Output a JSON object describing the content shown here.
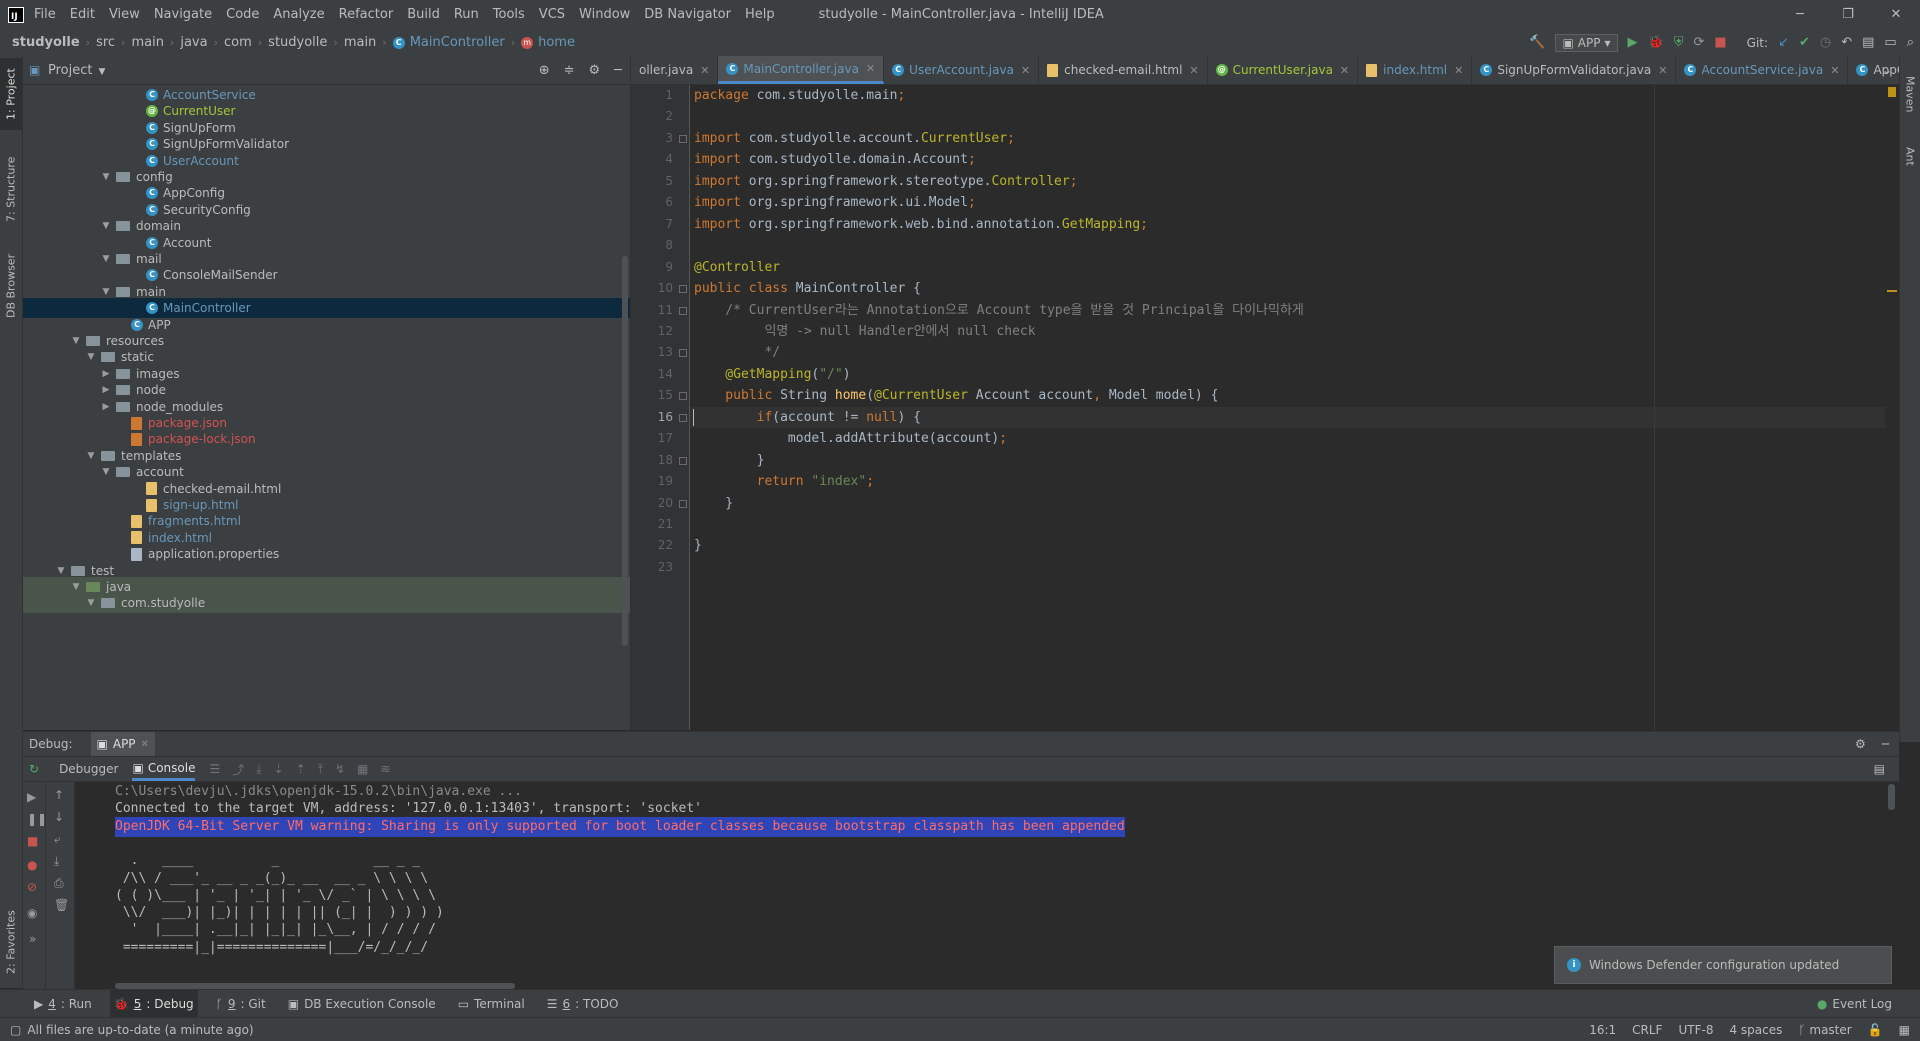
{
  "menubar": {
    "logo": "IJ",
    "items": [
      "File",
      "Edit",
      "View",
      "Navigate",
      "Code",
      "Analyze",
      "Refactor",
      "Build",
      "Run",
      "Tools",
      "VCS",
      "Window",
      "DB Navigator",
      "Help"
    ],
    "window_title": "studyolle - MainController.java - IntelliJ IDEA"
  },
  "navbar": {
    "crumbs": [
      "studyolle",
      "src",
      "main",
      "java",
      "com",
      "studyolle",
      "main",
      "MainController",
      "home"
    ],
    "run_config": "APP",
    "git_label": "Git:"
  },
  "left_strip": {
    "project": "1: Project",
    "structure": "7: Structure",
    "db_browser": "DB Browser",
    "favorites": "2: Favorites"
  },
  "right_strip": {
    "maven": "Maven",
    "ant": "Ant"
  },
  "project_panel": {
    "title": "Project",
    "tree": [
      {
        "label": "AccountService",
        "kind": "class",
        "depth": 7,
        "color": "#6897bb"
      },
      {
        "label": "CurrentUser",
        "kind": "annotation",
        "depth": 7,
        "color": "#a4c639"
      },
      {
        "label": "SignUpForm",
        "kind": "class",
        "depth": 7,
        "color": "#bbbbbb"
      },
      {
        "label": "SignUpFormValidator",
        "kind": "class",
        "depth": 7,
        "color": "#bbbbbb"
      },
      {
        "label": "UserAccount",
        "kind": "class",
        "depth": 7,
        "color": "#6897bb"
      },
      {
        "label": "config",
        "kind": "folder-open",
        "depth": 5,
        "color": "#bbbbbb"
      },
      {
        "label": "AppConfig",
        "kind": "class",
        "depth": 7,
        "color": "#bbbbbb"
      },
      {
        "label": "SecurityConfig",
        "kind": "class",
        "depth": 7,
        "color": "#bbbbbb"
      },
      {
        "label": "domain",
        "kind": "folder-open",
        "depth": 5,
        "color": "#bbbbbb"
      },
      {
        "label": "Account",
        "kind": "class",
        "depth": 7,
        "color": "#bbbbbb"
      },
      {
        "label": "mail",
        "kind": "folder-open",
        "depth": 5,
        "color": "#bbbbbb"
      },
      {
        "label": "ConsoleMailSender",
        "kind": "class",
        "depth": 7,
        "color": "#bbbbbb"
      },
      {
        "label": "main",
        "kind": "folder-open",
        "depth": 5,
        "color": "#bbbbbb"
      },
      {
        "label": "MainController",
        "kind": "class",
        "depth": 7,
        "color": "#6897bb",
        "selected": true
      },
      {
        "label": "APP",
        "kind": "app",
        "depth": 6,
        "color": "#bbbbbb"
      },
      {
        "label": "resources",
        "kind": "folder-open",
        "depth": 3,
        "color": "#bbbbbb"
      },
      {
        "label": "static",
        "kind": "folder-open",
        "depth": 4,
        "color": "#bbbbbb"
      },
      {
        "label": "images",
        "kind": "folder-closed",
        "depth": 5,
        "color": "#bbbbbb"
      },
      {
        "label": "node",
        "kind": "folder-closed",
        "depth": 5,
        "color": "#bbbbbb"
      },
      {
        "label": "node_modules",
        "kind": "folder-closed",
        "depth": 5,
        "color": "#bbbbbb"
      },
      {
        "label": "package.json",
        "kind": "json",
        "depth": 6,
        "color": "#d25252"
      },
      {
        "label": "package-lock.json",
        "kind": "json",
        "depth": 6,
        "color": "#d25252"
      },
      {
        "label": "templates",
        "kind": "folder-open",
        "depth": 4,
        "color": "#bbbbbb"
      },
      {
        "label": "account",
        "kind": "folder-open",
        "depth": 5,
        "color": "#bbbbbb"
      },
      {
        "label": "checked-email.html",
        "kind": "html",
        "depth": 7,
        "color": "#bbbbbb"
      },
      {
        "label": "sign-up.html",
        "kind": "html",
        "depth": 7,
        "color": "#6897bb"
      },
      {
        "label": "fragments.html",
        "kind": "html",
        "depth": 6,
        "color": "#6897bb"
      },
      {
        "label": "index.html",
        "kind": "html",
        "depth": 6,
        "color": "#6897bb"
      },
      {
        "label": "application.properties",
        "kind": "prop",
        "depth": 6,
        "color": "#bbbbbb"
      },
      {
        "label": "test",
        "kind": "folder-open",
        "depth": 2,
        "color": "#bbbbbb"
      },
      {
        "label": "java",
        "kind": "folder-green",
        "depth": 3,
        "color": "#bbbbbb",
        "test": true
      },
      {
        "label": "com.studyolle",
        "kind": "folder-open",
        "depth": 4,
        "color": "#bbbbbb",
        "test": true
      }
    ]
  },
  "editor": {
    "tabs": [
      {
        "label": "oller.java",
        "color": "#bbbbbb",
        "active": false
      },
      {
        "label": "MainController.java",
        "color": "#6897bb",
        "active": true
      },
      {
        "label": "UserAccount.java",
        "color": "#6897bb",
        "active": false
      },
      {
        "label": "checked-email.html",
        "color": "#bbbbbb",
        "active": false
      },
      {
        "label": "CurrentUser.java",
        "color": "#a4c639",
        "active": false
      },
      {
        "label": "index.html",
        "color": "#6897bb",
        "active": false
      },
      {
        "label": "SignUpFormValidator.java",
        "color": "#bbbbbb",
        "active": false
      },
      {
        "label": "AccountService.java",
        "color": "#6897bb",
        "active": false
      },
      {
        "label": "AppConfig.java",
        "color": "#bbbbbb",
        "active": false
      }
    ],
    "current_line": 16,
    "lines": [
      [
        [
          "kw",
          "package "
        ],
        [
          "t",
          "com.studyolle.main"
        ],
        [
          "kw",
          ";"
        ]
      ],
      [],
      [
        [
          "kw",
          "import "
        ],
        [
          "t",
          "com.studyolle.account."
        ],
        [
          "ann",
          "CurrentUser"
        ],
        [
          "kw",
          ";"
        ]
      ],
      [
        [
          "kw",
          "import "
        ],
        [
          "t",
          "com.studyolle.domain.Account"
        ],
        [
          "kw",
          ";"
        ]
      ],
      [
        [
          "kw",
          "import "
        ],
        [
          "t",
          "org.springframework.stereotype."
        ],
        [
          "ann",
          "Controller"
        ],
        [
          "kw",
          ";"
        ]
      ],
      [
        [
          "kw",
          "import "
        ],
        [
          "t",
          "org.springframework.ui.Model"
        ],
        [
          "kw",
          ";"
        ]
      ],
      [
        [
          "kw",
          "import "
        ],
        [
          "t",
          "org.springframework.web.bind.annotation."
        ],
        [
          "ann",
          "GetMapping"
        ],
        [
          "kw",
          ";"
        ]
      ],
      [],
      [
        [
          "ann",
          "@Controller"
        ]
      ],
      [
        [
          "kw",
          "public class "
        ],
        [
          "t",
          "MainController {"
        ]
      ],
      [
        [
          "cmt",
          "    /* CurrentUser라는 Annotation으로 Account type을 받을 것 Principal을 다이나믹하게"
        ]
      ],
      [
        [
          "cmt",
          "         익명 -> null Handler안에서 null check"
        ]
      ],
      [
        [
          "cmt",
          "         */"
        ]
      ],
      [
        [
          "ann",
          "    @GetMapping"
        ],
        [
          "t",
          "("
        ],
        [
          "str",
          "\"/\""
        ],
        [
          "t",
          ")"
        ]
      ],
      [
        [
          "kw",
          "    public "
        ],
        [
          "t",
          "String "
        ],
        [
          "fn",
          "home"
        ],
        [
          "t",
          "("
        ],
        [
          "ann",
          "@CurrentUser "
        ],
        [
          "t",
          "Account account"
        ],
        [
          "kw",
          ", "
        ],
        [
          "t",
          "Model model) {"
        ]
      ],
      [
        [
          "kw",
          "        if"
        ],
        [
          "t",
          "(account != "
        ],
        [
          "kw",
          "null"
        ],
        [
          "t",
          ") {"
        ]
      ],
      [
        [
          "t",
          "            model.addAttribute(account)"
        ],
        [
          "kw",
          ";"
        ]
      ],
      [
        [
          "t",
          "        }"
        ]
      ],
      [
        [
          "kw",
          "        return "
        ],
        [
          "str",
          "\"index\""
        ],
        [
          "kw",
          ";"
        ]
      ],
      [
        [
          "t",
          "    }"
        ]
      ],
      [],
      [
        [
          "t",
          "}"
        ]
      ],
      []
    ]
  },
  "debug": {
    "label": "Debug:",
    "session": "APP",
    "tabs": {
      "debugger": "Debugger",
      "console": "Console"
    },
    "console_lines": [
      {
        "text": "C:\\Users\\devju\\.jdks\\openjdk-15.0.2\\bin\\java.exe ...",
        "style": "gray"
      },
      {
        "text": "Connected to the target VM, address: '127.0.0.1:13403', transport: 'socket'",
        "style": "normal"
      },
      {
        "text": "OpenJDK 64-Bit Server VM warning: Sharing is only supported for boot loader classes because bootstrap classpath has been appended",
        "style": "warn"
      },
      {
        "text": "",
        "style": "normal"
      },
      {
        "text": "  .   ____          _            __ _ _",
        "style": "normal"
      },
      {
        "text": " /\\\\ / ___'_ __ _ _(_)_ __  __ _ \\ \\ \\ \\",
        "style": "normal"
      },
      {
        "text": "( ( )\\___ | '_ | '_| | '_ \\/ _` | \\ \\ \\ \\",
        "style": "normal"
      },
      {
        "text": " \\\\/  ___)| |_)| | | | | || (_| |  ) ) ) )",
        "style": "normal"
      },
      {
        "text": "  '  |____| .__|_| |_|_| |_\\__, | / / / /",
        "style": "normal"
      },
      {
        "text": " =========|_|==============|___/=/_/_/_/",
        "style": "normal"
      }
    ]
  },
  "bottom_tools": [
    {
      "num": "4",
      "label": ": Run",
      "active": false
    },
    {
      "num": "5",
      "label": ": Debug",
      "active": true
    },
    {
      "num": "9",
      "label": ": Git",
      "active": false
    },
    {
      "num": "",
      "label": "DB Execution Console",
      "active": false
    },
    {
      "num": "",
      "label": "Terminal",
      "active": false
    },
    {
      "num": "6",
      "label": ": TODO",
      "active": false
    }
  ],
  "event_log": "Event Log",
  "notification": "Windows Defender configuration updated",
  "status": {
    "message": "All files are up-to-date (a minute ago)",
    "position": "16:1",
    "line_sep": "CRLF",
    "encoding": "UTF-8",
    "indent": "4 spaces",
    "branch": "master"
  }
}
